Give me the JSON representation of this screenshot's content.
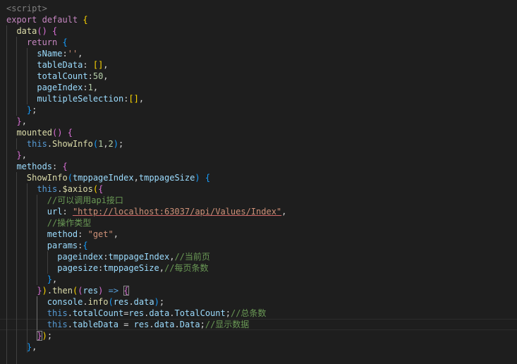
{
  "colors": {
    "background": "#1e1e1e",
    "tag": "#808080",
    "keyword": "#c586c0",
    "storage": "#569cd6",
    "function": "#dcdcaa",
    "property": "#9cdcfe",
    "string": "#ce9178",
    "number": "#b5cea8",
    "comment": "#6a9955",
    "text": "#d4d4d4",
    "bracket_gold": "#ffd700",
    "bracket_pink": "#da70d6",
    "bracket_blue": "#179fff"
  },
  "code_lines": [
    [
      {
        "t": "<script>",
        "c": "tag"
      }
    ],
    [
      {
        "t": "export",
        "c": "keyword"
      },
      {
        "t": " ",
        "c": "text"
      },
      {
        "t": "default",
        "c": "keyword"
      },
      {
        "t": " ",
        "c": "text"
      },
      {
        "t": "{",
        "c": "bracket_gold"
      }
    ],
    [
      {
        "t": "  ",
        "c": "text"
      },
      {
        "t": "data",
        "c": "function"
      },
      {
        "t": "()",
        "c": "bracket_pink"
      },
      {
        "t": " ",
        "c": "text"
      },
      {
        "t": "{",
        "c": "bracket_pink"
      }
    ],
    [
      {
        "t": "    ",
        "c": "text"
      },
      {
        "t": "return",
        "c": "keyword"
      },
      {
        "t": " ",
        "c": "text"
      },
      {
        "t": "{",
        "c": "bracket_blue"
      }
    ],
    [
      {
        "t": "      ",
        "c": "text"
      },
      {
        "t": "sName",
        "c": "property"
      },
      {
        "t": ":",
        "c": "text"
      },
      {
        "t": "''",
        "c": "string"
      },
      {
        "t": ",",
        "c": "text"
      }
    ],
    [
      {
        "t": "      ",
        "c": "text"
      },
      {
        "t": "tableData",
        "c": "property"
      },
      {
        "t": ": ",
        "c": "text"
      },
      {
        "t": "[]",
        "c": "bracket_gold"
      },
      {
        "t": ",",
        "c": "text"
      }
    ],
    [
      {
        "t": "      ",
        "c": "text"
      },
      {
        "t": "totalCount",
        "c": "property"
      },
      {
        "t": ":",
        "c": "text"
      },
      {
        "t": "50",
        "c": "number"
      },
      {
        "t": ",",
        "c": "text"
      }
    ],
    [
      {
        "t": "      ",
        "c": "text"
      },
      {
        "t": "pageIndex",
        "c": "property"
      },
      {
        "t": ":",
        "c": "text"
      },
      {
        "t": "1",
        "c": "number"
      },
      {
        "t": ",",
        "c": "text"
      }
    ],
    [
      {
        "t": "      ",
        "c": "text"
      },
      {
        "t": "multipleSelection",
        "c": "property"
      },
      {
        "t": ":",
        "c": "text"
      },
      {
        "t": "[]",
        "c": "bracket_gold"
      },
      {
        "t": ",",
        "c": "text"
      }
    ],
    [
      {
        "t": "    ",
        "c": "text"
      },
      {
        "t": "}",
        "c": "bracket_blue"
      },
      {
        "t": ";",
        "c": "text"
      }
    ],
    [
      {
        "t": "  ",
        "c": "text"
      },
      {
        "t": "}",
        "c": "bracket_pink"
      },
      {
        "t": ",",
        "c": "text"
      }
    ],
    [
      {
        "t": "  ",
        "c": "text"
      },
      {
        "t": "mounted",
        "c": "function"
      },
      {
        "t": "()",
        "c": "bracket_pink"
      },
      {
        "t": " ",
        "c": "text"
      },
      {
        "t": "{",
        "c": "bracket_pink"
      }
    ],
    [
      {
        "t": "    ",
        "c": "text"
      },
      {
        "t": "this",
        "c": "storage"
      },
      {
        "t": ".",
        "c": "text"
      },
      {
        "t": "ShowInfo",
        "c": "function"
      },
      {
        "t": "(",
        "c": "bracket_blue"
      },
      {
        "t": "1",
        "c": "number"
      },
      {
        "t": ",",
        "c": "text"
      },
      {
        "t": "2",
        "c": "number"
      },
      {
        "t": ")",
        "c": "bracket_blue"
      },
      {
        "t": ";",
        "c": "text"
      }
    ],
    [
      {
        "t": "  ",
        "c": "text"
      },
      {
        "t": "}",
        "c": "bracket_pink"
      },
      {
        "t": ",",
        "c": "text"
      }
    ],
    [
      {
        "t": "  ",
        "c": "text"
      },
      {
        "t": "methods",
        "c": "property"
      },
      {
        "t": ": ",
        "c": "text"
      },
      {
        "t": "{",
        "c": "bracket_pink"
      }
    ],
    [
      {
        "t": "    ",
        "c": "text"
      },
      {
        "t": "ShowInfo",
        "c": "function"
      },
      {
        "t": "(",
        "c": "bracket_blue"
      },
      {
        "t": "tmppageIndex",
        "c": "property"
      },
      {
        "t": ",",
        "c": "text"
      },
      {
        "t": "tmppageSize",
        "c": "property"
      },
      {
        "t": ")",
        "c": "bracket_blue"
      },
      {
        "t": " ",
        "c": "text"
      },
      {
        "t": "{",
        "c": "bracket_blue"
      }
    ],
    [
      {
        "t": "      ",
        "c": "text"
      },
      {
        "t": "this",
        "c": "storage"
      },
      {
        "t": ".",
        "c": "text"
      },
      {
        "t": "$axios",
        "c": "function"
      },
      {
        "t": "(",
        "c": "bracket_gold"
      },
      {
        "t": "{",
        "c": "bracket_pink"
      }
    ],
    [
      {
        "t": "        ",
        "c": "text"
      },
      {
        "t": "//可以调用api接口",
        "c": "comment"
      }
    ],
    [
      {
        "t": "        ",
        "c": "text"
      },
      {
        "t": "url",
        "c": "property"
      },
      {
        "t": ": ",
        "c": "text"
      },
      {
        "t": "\"http://localhost:63037/api/Values/Index\"",
        "c": "string",
        "u": true
      },
      {
        "t": ",",
        "c": "text"
      }
    ],
    [
      {
        "t": "        ",
        "c": "text"
      },
      {
        "t": "//操作类型",
        "c": "comment"
      }
    ],
    [
      {
        "t": "        ",
        "c": "text"
      },
      {
        "t": "method",
        "c": "property"
      },
      {
        "t": ": ",
        "c": "text"
      },
      {
        "t": "\"get\"",
        "c": "string"
      },
      {
        "t": ",",
        "c": "text"
      }
    ],
    [
      {
        "t": "        ",
        "c": "text"
      },
      {
        "t": "params",
        "c": "property"
      },
      {
        "t": ":",
        "c": "text"
      },
      {
        "t": "{",
        "c": "bracket_blue"
      }
    ],
    [
      {
        "t": "          ",
        "c": "text"
      },
      {
        "t": "pageindex",
        "c": "property"
      },
      {
        "t": ":",
        "c": "text"
      },
      {
        "t": "tmppageIndex",
        "c": "property"
      },
      {
        "t": ",",
        "c": "text"
      },
      {
        "t": "//当前页",
        "c": "comment"
      }
    ],
    [
      {
        "t": "          ",
        "c": "text"
      },
      {
        "t": "pagesize",
        "c": "property"
      },
      {
        "t": ":",
        "c": "text"
      },
      {
        "t": "tmppageSize",
        "c": "property"
      },
      {
        "t": ",",
        "c": "text"
      },
      {
        "t": "//每页条数",
        "c": "comment"
      }
    ],
    [
      {
        "t": "        ",
        "c": "text"
      },
      {
        "t": "}",
        "c": "bracket_blue"
      },
      {
        "t": ",",
        "c": "text"
      }
    ],
    [
      {
        "t": "      ",
        "c": "text"
      },
      {
        "t": "}",
        "c": "bracket_pink"
      },
      {
        "t": ")",
        "c": "bracket_gold"
      },
      {
        "t": ".",
        "c": "text"
      },
      {
        "t": "then",
        "c": "function"
      },
      {
        "t": "(",
        "c": "bracket_gold"
      },
      {
        "t": "(",
        "c": "bracket_pink"
      },
      {
        "t": "res",
        "c": "property"
      },
      {
        "t": ")",
        "c": "bracket_pink"
      },
      {
        "t": " ",
        "c": "text"
      },
      {
        "t": "=>",
        "c": "storage"
      },
      {
        "t": " ",
        "c": "text"
      },
      {
        "t": "{",
        "c": "bracket_pink",
        "box": true
      }
    ],
    [
      {
        "t": "        ",
        "c": "text"
      },
      {
        "t": "console",
        "c": "property"
      },
      {
        "t": ".",
        "c": "text"
      },
      {
        "t": "info",
        "c": "function"
      },
      {
        "t": "(",
        "c": "bracket_blue"
      },
      {
        "t": "res",
        "c": "property"
      },
      {
        "t": ".",
        "c": "text"
      },
      {
        "t": "data",
        "c": "property"
      },
      {
        "t": ")",
        "c": "bracket_blue"
      },
      {
        "t": ";",
        "c": "text"
      }
    ],
    [
      {
        "t": "        ",
        "c": "text"
      },
      {
        "t": "this",
        "c": "storage"
      },
      {
        "t": ".",
        "c": "text"
      },
      {
        "t": "totalCount",
        "c": "property"
      },
      {
        "t": "=",
        "c": "text"
      },
      {
        "t": "res",
        "c": "property"
      },
      {
        "t": ".",
        "c": "text"
      },
      {
        "t": "data",
        "c": "property"
      },
      {
        "t": ".",
        "c": "text"
      },
      {
        "t": "TotalCount",
        "c": "property"
      },
      {
        "t": ";",
        "c": "text"
      },
      {
        "t": "//总条数",
        "c": "comment"
      }
    ],
    [
      {
        "t": "        ",
        "c": "text"
      },
      {
        "t": "this",
        "c": "storage"
      },
      {
        "t": ".",
        "c": "text"
      },
      {
        "t": "tableData",
        "c": "property"
      },
      {
        "t": " = ",
        "c": "text"
      },
      {
        "t": "res",
        "c": "property"
      },
      {
        "t": ".",
        "c": "text"
      },
      {
        "t": "data",
        "c": "property"
      },
      {
        "t": ".",
        "c": "text"
      },
      {
        "t": "Data",
        "c": "property"
      },
      {
        "t": ";",
        "c": "text"
      },
      {
        "t": "//显示数据",
        "c": "comment"
      }
    ],
    [
      {
        "t": "      ",
        "c": "text"
      },
      {
        "t": "}",
        "c": "bracket_pink",
        "box": true
      },
      {
        "t": ")",
        "c": "bracket_gold"
      },
      {
        "t": ";",
        "c": "text"
      }
    ],
    [
      {
        "t": "    ",
        "c": "text"
      },
      {
        "t": "}",
        "c": "bracket_blue"
      },
      {
        "t": ",",
        "c": "text"
      }
    ]
  ]
}
